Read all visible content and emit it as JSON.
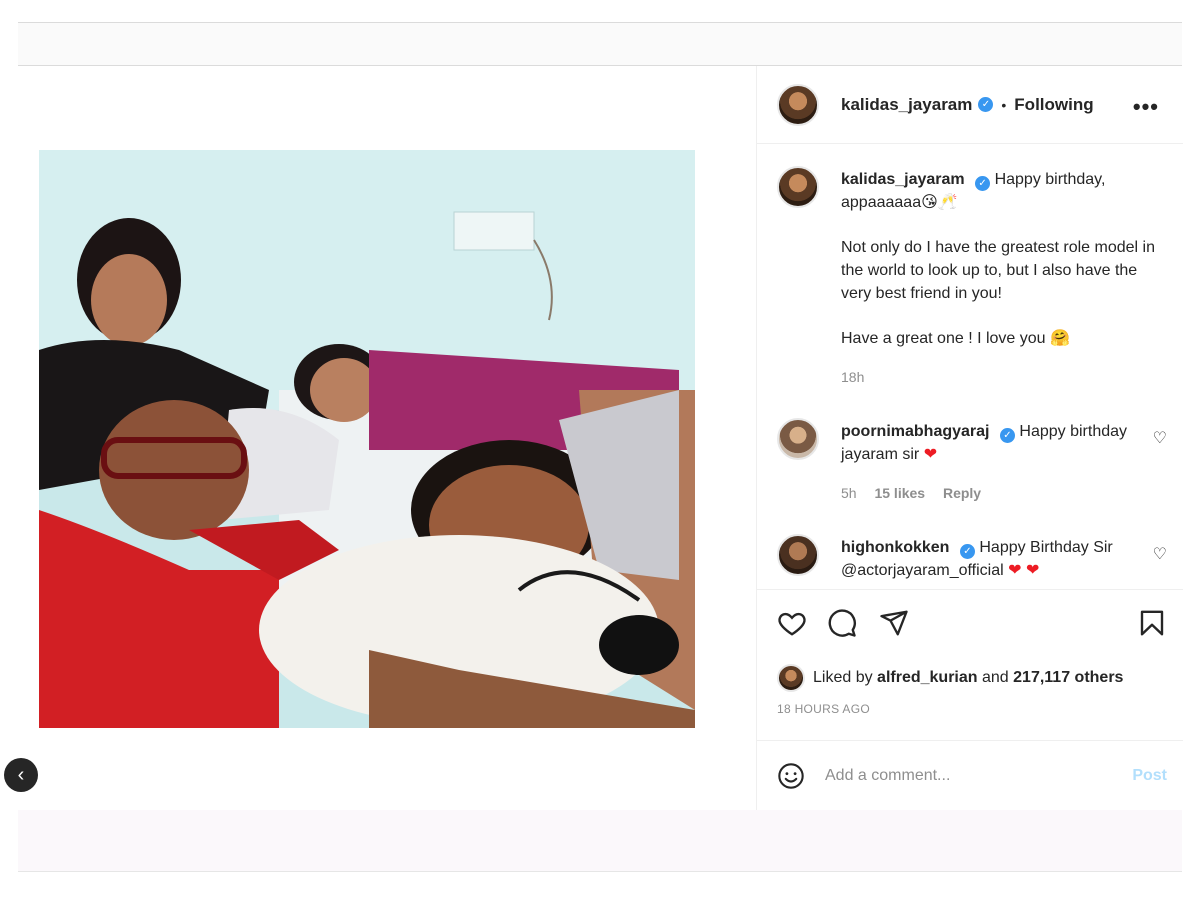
{
  "header": {
    "username": "kalidas_jayaram",
    "separator": "•",
    "follow_status": "Following"
  },
  "caption": {
    "username": "kalidas_jayaram",
    "line1": "Happy birthday, appaaaaaa😘🥂",
    "para2": "Not only do I have the greatest role model in the world to look up to, but I also have the very best friend in you!",
    "para3": "Have a great one ! I love you 🤗",
    "time": "18h"
  },
  "comments": [
    {
      "username": "poornimabhagyaraj",
      "text": "Happy birthday jayaram sir",
      "emoji": "❤",
      "time": "5h",
      "likes": "15 likes",
      "reply": "Reply"
    },
    {
      "username": "highonkokken",
      "text": "Happy Birthday Sir @actorjayaram_official",
      "emoji": "❤ ❤"
    }
  ],
  "likes": {
    "prefix": "Liked by",
    "user": "alfred_kurian",
    "middle": "and",
    "others": "217,117 others"
  },
  "timestamp": "18 HOURS AGO",
  "add_comment": {
    "placeholder": "Add a comment...",
    "post_label": "Post"
  },
  "icons": {
    "verified": "verified-badge-icon",
    "more": "more-options-icon",
    "like": "heart-icon",
    "comment": "comment-bubble-icon",
    "share": "paper-plane-icon",
    "save": "bookmark-icon",
    "emoji": "smiley-icon"
  },
  "colors": {
    "verified": "#3897f0",
    "post_disabled": "#b2dffc",
    "secondary_text": "#8e8e8e"
  }
}
